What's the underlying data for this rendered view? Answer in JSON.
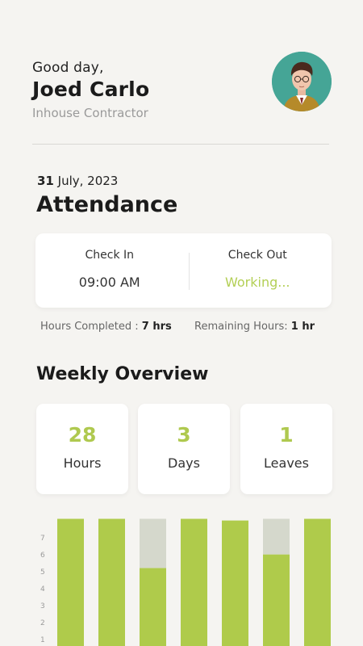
{
  "header": {
    "greeting": "Good day,",
    "name": "Joed Carlo",
    "role": "Inhouse Contractor"
  },
  "attendance": {
    "date_day": "31",
    "date_rest": "July, 2023",
    "title": "Attendance",
    "check_in_label": "Check In",
    "check_in_value": "09:00 AM",
    "check_out_label": "Check Out",
    "check_out_value": "Working...",
    "hours_completed_label": "Hours Completed :",
    "hours_completed_value": "7 hrs",
    "remaining_label": "Remaining Hours:",
    "remaining_value": "1 hr"
  },
  "weekly": {
    "title": "Weekly Overview",
    "stats": [
      {
        "value": "28",
        "label": "Hours"
      },
      {
        "value": "3",
        "label": "Days"
      },
      {
        "value": "1",
        "label": "Leaves"
      }
    ]
  },
  "colors": {
    "accent": "#b3cf55",
    "bar_fill": "#afcb4b",
    "bar_remaining": "#d5d8cc",
    "background": "#f5f4f1"
  },
  "icons": {
    "avatar": "user-avatar"
  },
  "chart_data": {
    "type": "bar",
    "categories": [
      "",
      "",
      "",
      "",
      "",
      "",
      ""
    ],
    "y_ticks": [
      "1",
      "2",
      "3",
      "4",
      "5",
      "6",
      "7"
    ],
    "ylim": [
      0,
      7.5
    ],
    "series": [
      {
        "values": [
          7.5,
          7.5,
          4.6,
          7.5,
          7.4,
          5.4,
          7.5
        ]
      },
      {
        "values": [
          0,
          0,
          2.9,
          0,
          0,
          2.1,
          0
        ]
      }
    ],
    "grid": false,
    "legend": "none"
  }
}
